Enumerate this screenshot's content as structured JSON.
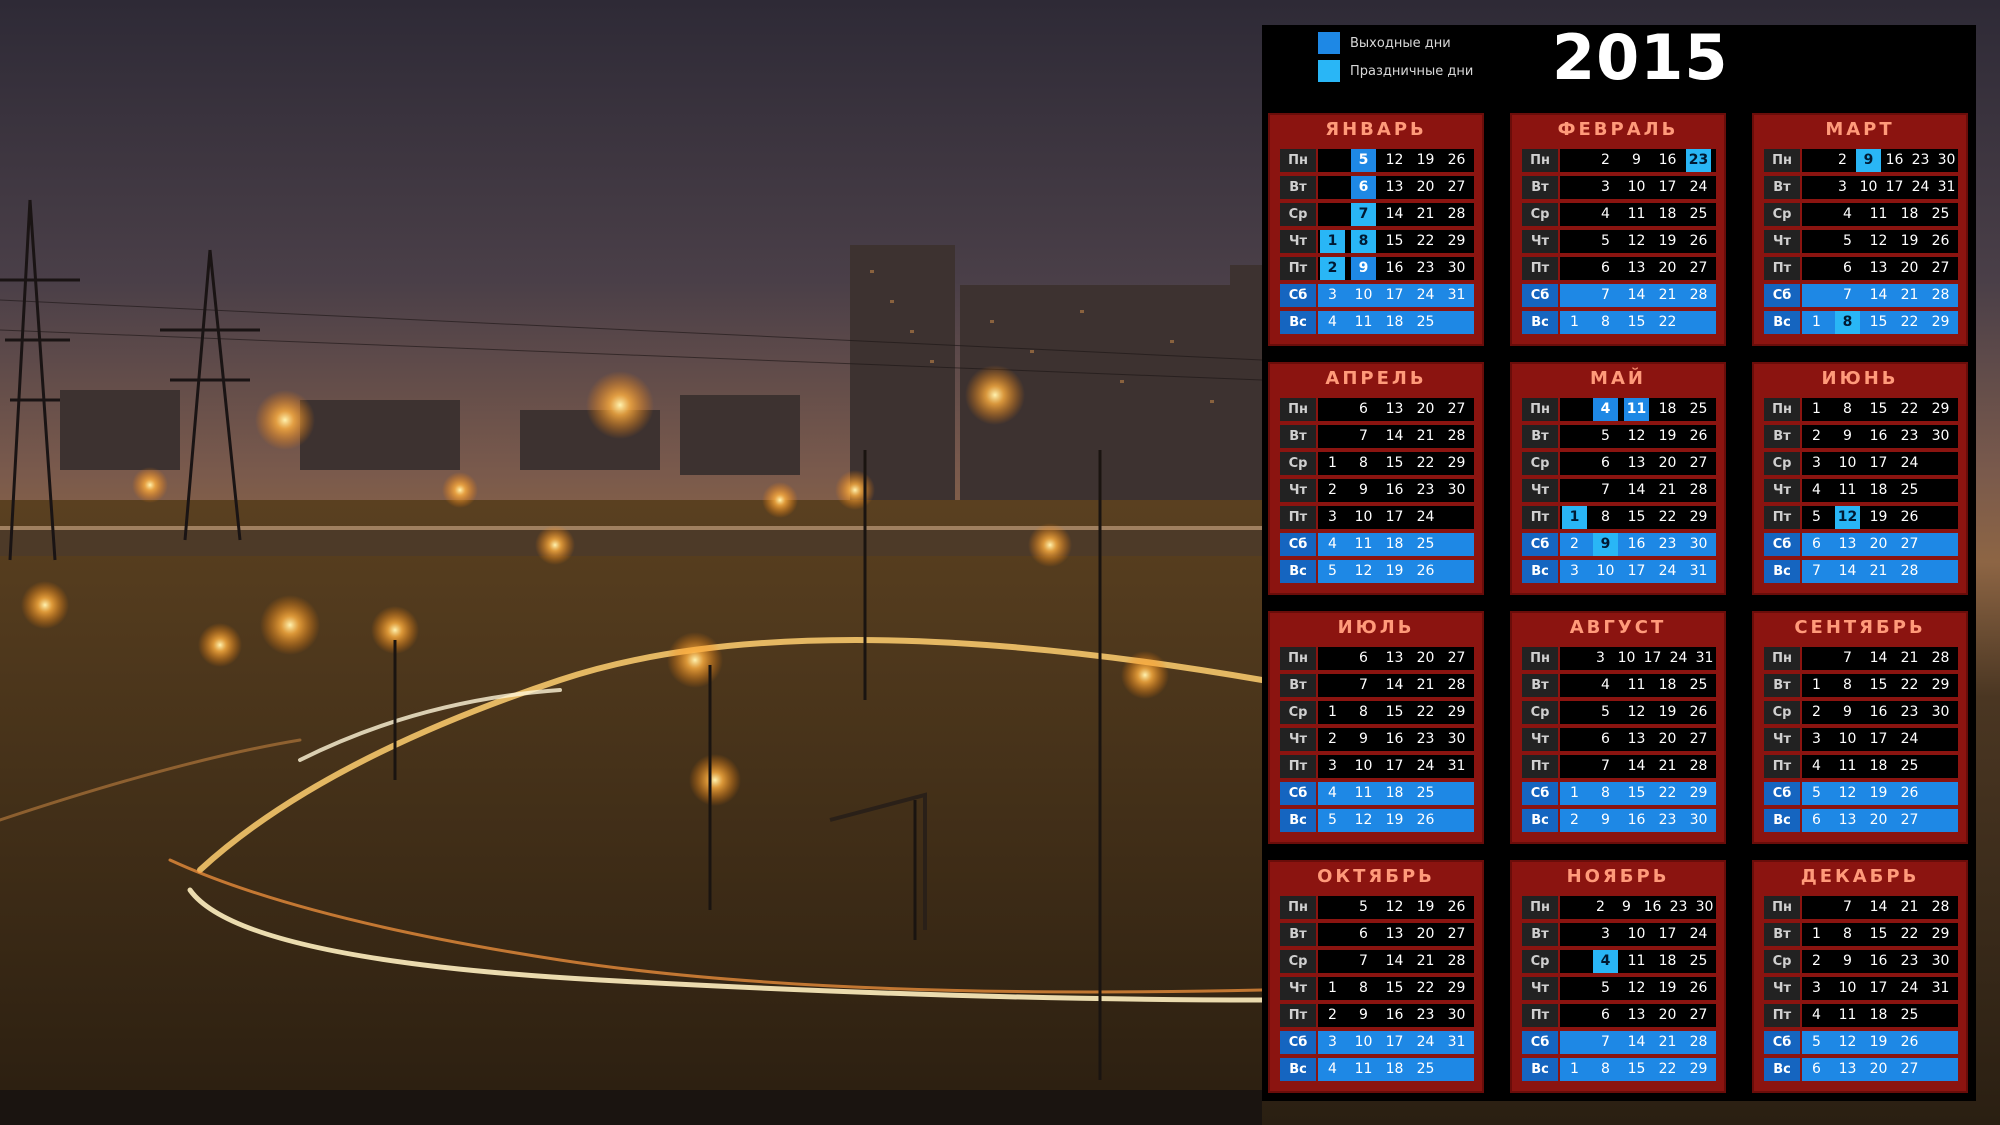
{
  "legend": {
    "weekends_label": "Выходные дни",
    "holidays_label": "Праздничные дни"
  },
  "year": "2015",
  "day_names": [
    "Пн",
    "Вт",
    "Ср",
    "Чт",
    "Пт",
    "Сб",
    "Вс"
  ],
  "months": [
    {
      "name": "ЯНВАРЬ",
      "rows": [
        [
          "",
          "5",
          "12",
          "19",
          "26"
        ],
        [
          "",
          "6",
          "13",
          "20",
          "27"
        ],
        [
          "",
          "7",
          "14",
          "21",
          "28"
        ],
        [
          "1",
          "8",
          "15",
          "22",
          "29"
        ],
        [
          "2",
          "9",
          "16",
          "23",
          "30"
        ],
        [
          "3",
          "10",
          "17",
          "24",
          "31"
        ],
        [
          "4",
          "11",
          "18",
          "25",
          ""
        ]
      ],
      "holidays": [
        "1",
        "2",
        "7",
        "8"
      ],
      "weekday_offs": [
        "5",
        "6",
        "9"
      ]
    },
    {
      "name": "ФЕВРАЛЬ",
      "rows": [
        [
          "",
          "2",
          "9",
          "16",
          "23"
        ],
        [
          "",
          "3",
          "10",
          "17",
          "24"
        ],
        [
          "",
          "4",
          "11",
          "18",
          "25"
        ],
        [
          "",
          "5",
          "12",
          "19",
          "26"
        ],
        [
          "",
          "6",
          "13",
          "20",
          "27"
        ],
        [
          "",
          "7",
          "14",
          "21",
          "28"
        ],
        [
          "1",
          "8",
          "15",
          "22",
          ""
        ]
      ],
      "holidays": [
        "23"
      ],
      "weekday_offs": []
    },
    {
      "name": "МАРТ",
      "rows": [
        [
          "",
          "2",
          "9",
          "16",
          "23",
          "30"
        ],
        [
          "",
          "3",
          "10",
          "17",
          "24",
          "31"
        ],
        [
          "",
          "4",
          "11",
          "18",
          "25"
        ],
        [
          "",
          "5",
          "12",
          "19",
          "26"
        ],
        [
          "",
          "6",
          "13",
          "20",
          "27"
        ],
        [
          "",
          "7",
          "14",
          "21",
          "28"
        ],
        [
          "1",
          "8",
          "15",
          "22",
          "29"
        ]
      ],
      "holidays": [
        "9",
        "8"
      ],
      "weekday_offs": []
    },
    {
      "name": "АПРЕЛЬ",
      "rows": [
        [
          "",
          "6",
          "13",
          "20",
          "27"
        ],
        [
          "",
          "7",
          "14",
          "21",
          "28"
        ],
        [
          "1",
          "8",
          "15",
          "22",
          "29"
        ],
        [
          "2",
          "9",
          "16",
          "23",
          "30"
        ],
        [
          "3",
          "10",
          "17",
          "24",
          ""
        ],
        [
          "4",
          "11",
          "18",
          "25",
          ""
        ],
        [
          "5",
          "12",
          "19",
          "26",
          ""
        ]
      ],
      "holidays": [],
      "weekday_offs": []
    },
    {
      "name": "МАЙ",
      "rows": [
        [
          "",
          "4",
          "11",
          "18",
          "25"
        ],
        [
          "",
          "5",
          "12",
          "19",
          "26"
        ],
        [
          "",
          "6",
          "13",
          "20",
          "27"
        ],
        [
          "",
          "7",
          "14",
          "21",
          "28"
        ],
        [
          "1",
          "8",
          "15",
          "22",
          "29"
        ],
        [
          "2",
          "9",
          "16",
          "23",
          "30"
        ],
        [
          "3",
          "10",
          "17",
          "24",
          "31"
        ]
      ],
      "holidays": [
        "1",
        "9"
      ],
      "weekday_offs": [
        "4",
        "11"
      ]
    },
    {
      "name": "ИЮНЬ",
      "rows": [
        [
          "1",
          "8",
          "15",
          "22",
          "29"
        ],
        [
          "2",
          "9",
          "16",
          "23",
          "30"
        ],
        [
          "3",
          "10",
          "17",
          "24",
          ""
        ],
        [
          "4",
          "11",
          "18",
          "25",
          ""
        ],
        [
          "5",
          "12",
          "19",
          "26",
          ""
        ],
        [
          "6",
          "13",
          "20",
          "27",
          ""
        ],
        [
          "7",
          "14",
          "21",
          "28",
          ""
        ]
      ],
      "holidays": [
        "12"
      ],
      "weekday_offs": []
    },
    {
      "name": "ИЮЛЬ",
      "rows": [
        [
          "",
          "6",
          "13",
          "20",
          "27"
        ],
        [
          "",
          "7",
          "14",
          "21",
          "28"
        ],
        [
          "1",
          "8",
          "15",
          "22",
          "29"
        ],
        [
          "2",
          "9",
          "16",
          "23",
          "30"
        ],
        [
          "3",
          "10",
          "17",
          "24",
          "31"
        ],
        [
          "4",
          "11",
          "18",
          "25",
          ""
        ],
        [
          "5",
          "12",
          "19",
          "26",
          ""
        ]
      ],
      "holidays": [],
      "weekday_offs": []
    },
    {
      "name": "АВГУСТ",
      "rows": [
        [
          "",
          "3",
          "10",
          "17",
          "24",
          "31"
        ],
        [
          "",
          "4",
          "11",
          "18",
          "25"
        ],
        [
          "",
          "5",
          "12",
          "19",
          "26"
        ],
        [
          "",
          "6",
          "13",
          "20",
          "27"
        ],
        [
          "",
          "7",
          "14",
          "21",
          "28"
        ],
        [
          "1",
          "8",
          "15",
          "22",
          "29"
        ],
        [
          "2",
          "9",
          "16",
          "23",
          "30"
        ]
      ],
      "holidays": [],
      "weekday_offs": []
    },
    {
      "name": "СЕНТЯБРЬ",
      "rows": [
        [
          "",
          "7",
          "14",
          "21",
          "28"
        ],
        [
          "1",
          "8",
          "15",
          "22",
          "29"
        ],
        [
          "2",
          "9",
          "16",
          "23",
          "30"
        ],
        [
          "3",
          "10",
          "17",
          "24",
          ""
        ],
        [
          "4",
          "11",
          "18",
          "25",
          ""
        ],
        [
          "5",
          "12",
          "19",
          "26",
          ""
        ],
        [
          "6",
          "13",
          "20",
          "27",
          ""
        ]
      ],
      "holidays": [],
      "weekday_offs": []
    },
    {
      "name": "ОКТЯБРЬ",
      "rows": [
        [
          "",
          "5",
          "12",
          "19",
          "26"
        ],
        [
          "",
          "6",
          "13",
          "20",
          "27"
        ],
        [
          "",
          "7",
          "14",
          "21",
          "28"
        ],
        [
          "1",
          "8",
          "15",
          "22",
          "29"
        ],
        [
          "2",
          "9",
          "16",
          "23",
          "30"
        ],
        [
          "3",
          "10",
          "17",
          "24",
          "31"
        ],
        [
          "4",
          "11",
          "18",
          "25",
          ""
        ]
      ],
      "holidays": [],
      "weekday_offs": []
    },
    {
      "name": "НОЯБРЬ",
      "rows": [
        [
          "",
          "2",
          "9",
          "16",
          "23",
          "30"
        ],
        [
          "",
          "3",
          "10",
          "17",
          "24"
        ],
        [
          "",
          "4",
          "11",
          "18",
          "25"
        ],
        [
          "",
          "5",
          "12",
          "19",
          "26"
        ],
        [
          "",
          "6",
          "13",
          "20",
          "27"
        ],
        [
          "",
          "7",
          "14",
          "21",
          "28"
        ],
        [
          "1",
          "8",
          "15",
          "22",
          "29"
        ]
      ],
      "holidays": [
        "4"
      ],
      "weekday_offs": []
    },
    {
      "name": "ДЕКАБРЬ",
      "rows": [
        [
          "",
          "7",
          "14",
          "21",
          "28"
        ],
        [
          "1",
          "8",
          "15",
          "22",
          "29"
        ],
        [
          "2",
          "9",
          "16",
          "23",
          "30"
        ],
        [
          "3",
          "10",
          "17",
          "24",
          "31"
        ],
        [
          "4",
          "11",
          "18",
          "25",
          ""
        ],
        [
          "5",
          "12",
          "19",
          "26",
          ""
        ],
        [
          "6",
          "13",
          "20",
          "27",
          ""
        ]
      ],
      "holidays": [],
      "weekday_offs": []
    }
  ],
  "colors": {
    "weekend": "#1e88e5",
    "holiday": "#29b6f6",
    "month_bg": "#8b1410",
    "month_title": "#ff9a7a"
  }
}
